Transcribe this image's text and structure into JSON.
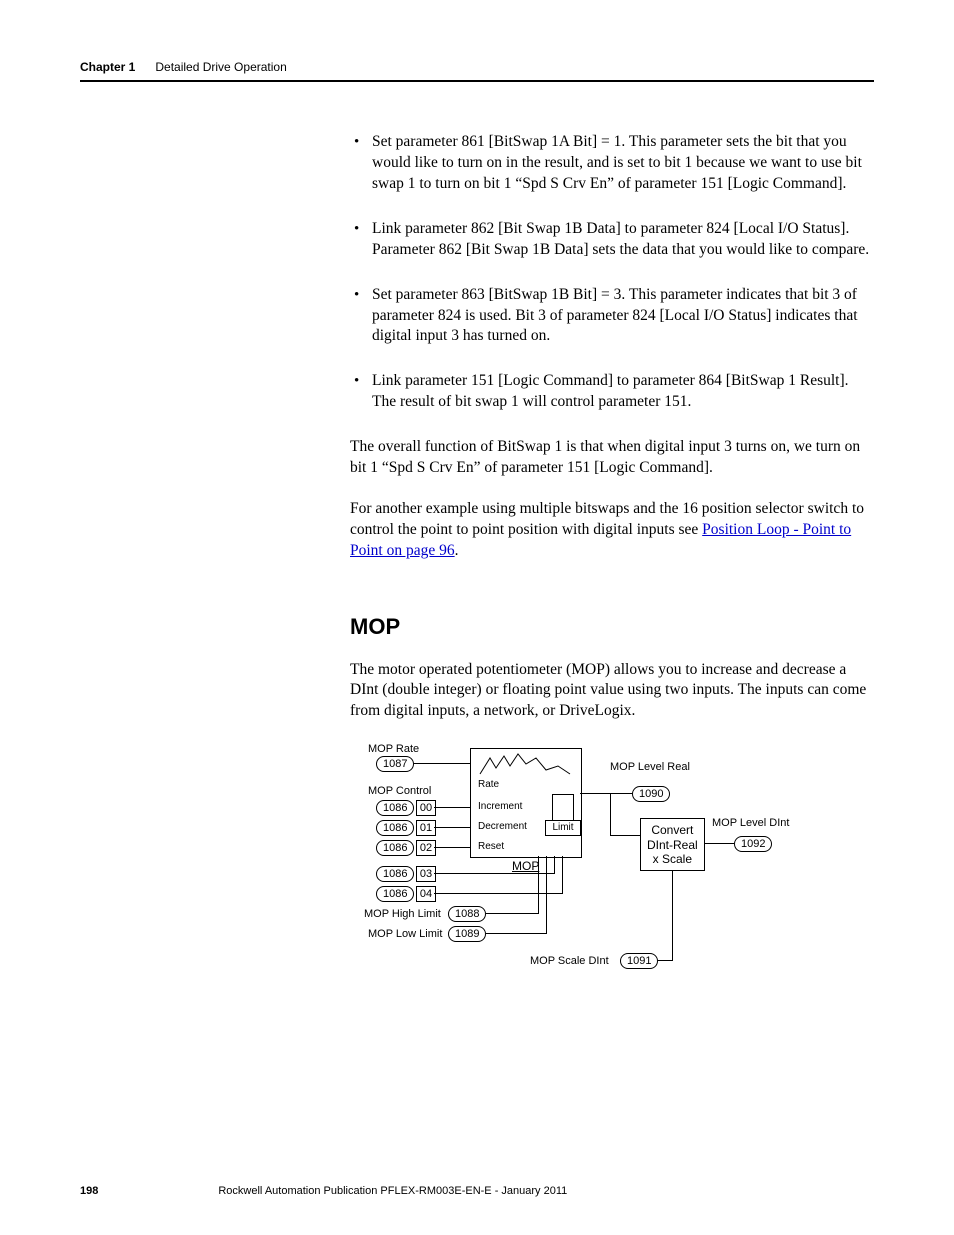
{
  "header": {
    "chapter": "Chapter 1",
    "title": "Detailed Drive Operation"
  },
  "bullets": [
    "Set parameter 861 [BitSwap 1A Bit] = 1. This parameter sets the bit that you would like to turn on in the result, and is set to bit 1 because we want to use bit swap 1 to turn on bit 1 “Spd S Crv En” of parameter 151 [Logic Command].",
    "Link parameter 862 [Bit Swap 1B Data] to parameter 824 [Local I/O Status]. Parameter 862 [Bit Swap 1B Data] sets the data that you would like to compare.",
    "Set parameter 863 [BitSwap 1B Bit] = 3. This parameter indicates that bit 3 of parameter 824 is used. Bit 3 of parameter 824 [Local I/O Status] indicates that digital input 3 has turned on.",
    "Link parameter 151 [Logic Command] to parameter 864 [BitSwap 1 Result]. The result of bit swap 1 will control parameter 151."
  ],
  "para1": "The overall function of BitSwap 1 is that when digital input 3 turns on, we turn on bit 1 “Spd S Crv En” of parameter 151 [Logic Command].",
  "para2_pre": "For another example using multiple bitswaps and the 16 position selector switch to control the point to point position with digital inputs see ",
  "para2_link": "Position Loop - Point to Point on page 96",
  "para2_post": ".",
  "section_heading": "MOP",
  "section_para": "The motor operated potentiometer (MOP) allows you to increase and decrease a DInt (double integer) or floating point value using two inputs. The inputs can come from digital inputs, a network, or DriveLogix.",
  "diagram": {
    "labels": {
      "mop_rate": "MOP Rate",
      "mop_control": "MOP Control",
      "mop_high_limit": "MOP High Limit",
      "mop_low_limit": "MOP Low Limit",
      "mop_level_real": "MOP Level Real",
      "mop_level_dint": "MOP Level DInt",
      "mop_scale_dint": "MOP Scale DInt",
      "rate": "Rate",
      "increment": "Increment",
      "decrement": "Decrement",
      "reset": "Reset",
      "limit": "Limit",
      "mop_box": "MOP",
      "convert_line1": "Convert",
      "convert_line2": "DInt-Real",
      "convert_line3": "x Scale"
    },
    "params": {
      "p1087": "1087",
      "p1086": "1086",
      "p1088": "1088",
      "p1089": "1089",
      "p1090": "1090",
      "p1091": "1091",
      "p1092": "1092",
      "b00": "00",
      "b01": "01",
      "b02": "02",
      "b03": "03",
      "b04": "04"
    }
  },
  "footer": {
    "page": "198",
    "pub": "Rockwell Automation Publication PFLEX-RM003E-EN-E - January 2011"
  }
}
